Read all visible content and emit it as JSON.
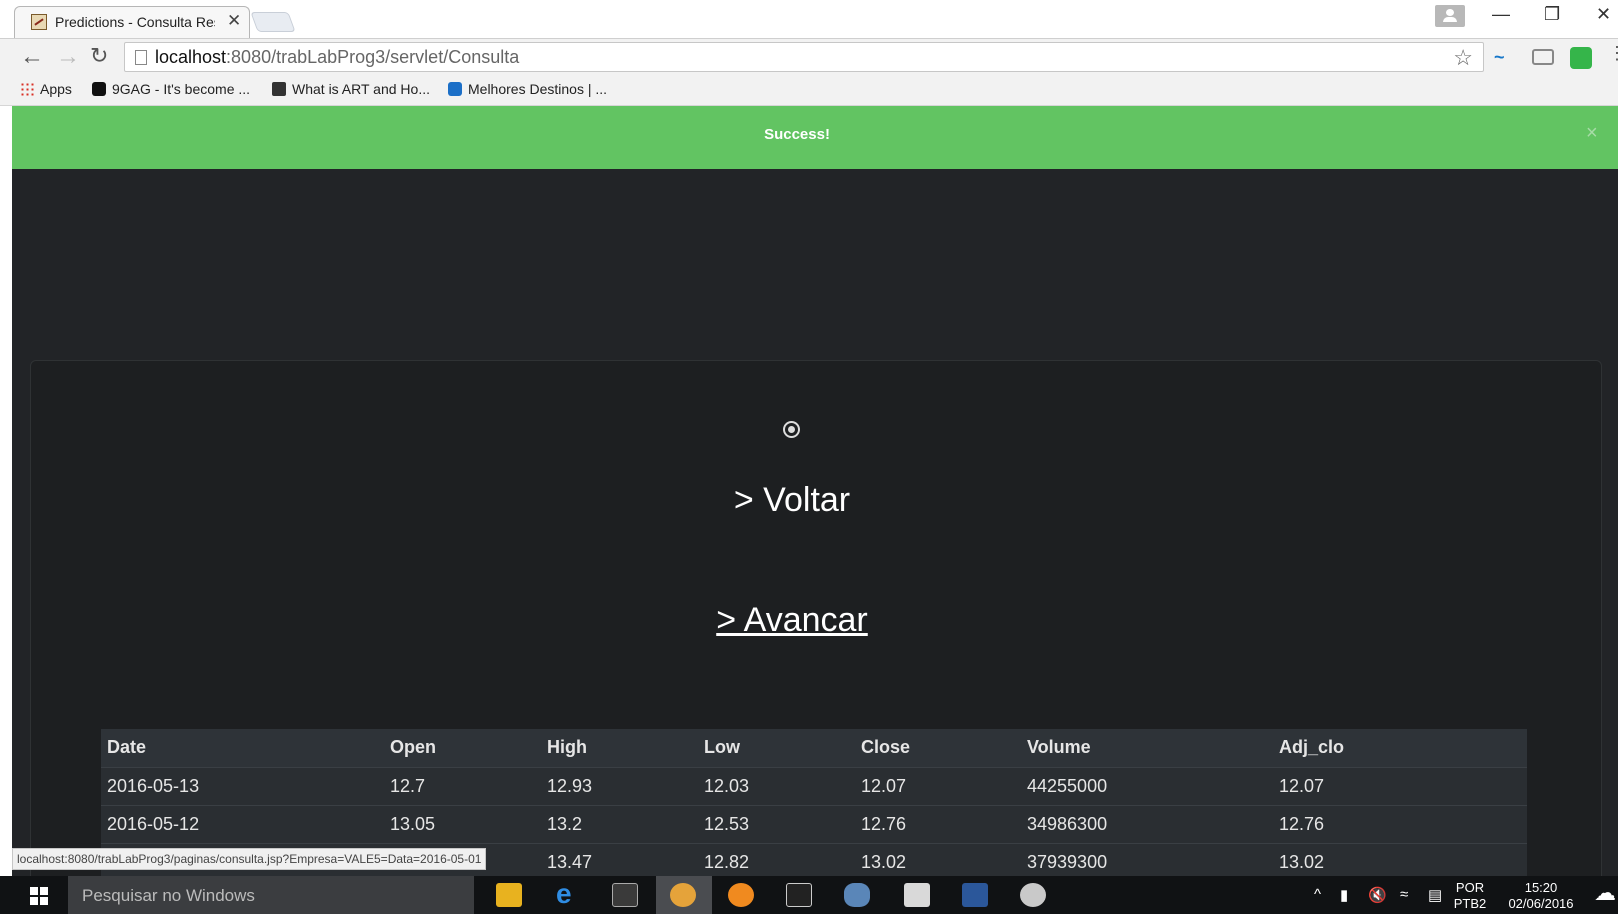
{
  "browser": {
    "tab_title": "Predictions - Consulta Res",
    "tab_close": "✕",
    "url_host": "localhost",
    "url_rest": ":8080/trabLabProg3/servlet/Consulta",
    "bookmarks": [
      "Apps",
      "9GAG - It's become ...",
      "What is ART and Ho...",
      "Melhores Destinos | ..."
    ]
  },
  "alert": {
    "text": "Success!",
    "close": "×",
    "color": "#62c462"
  },
  "links": {
    "voltar": "> Voltar",
    "avancar": "> Avancar"
  },
  "table": {
    "headers": [
      "Date",
      "Open",
      "High",
      "Low",
      "Close",
      "Volume",
      "Adj_clo"
    ],
    "rows": [
      [
        "2016-05-13",
        "12.7",
        "12.93",
        "12.03",
        "12.07",
        "44255000",
        "12.07"
      ],
      [
        "2016-05-12",
        "13.05",
        "13.2",
        "12.53",
        "12.76",
        "34986300",
        "12.76"
      ],
      [
        "",
        "",
        "13.47",
        "12.82",
        "13.02",
        "37939300",
        "13.02"
      ]
    ]
  },
  "status_url": "localhost:8080/trabLabProg3/paginas/consulta.jsp?Empresa=VALE5=Data=2016-05-01",
  "taskbar": {
    "search_placeholder": "Pesquisar no Windows",
    "lang_top": "POR",
    "lang_bottom": "PTB2",
    "time": "15:20",
    "date": "02/06/2016"
  },
  "icons": [
    "favicon-icon",
    "back-icon",
    "forward-icon",
    "reload-icon",
    "page-icon",
    "star-icon",
    "windows-start-icon",
    "file-explorer-icon",
    "edge-icon",
    "firefox-icon"
  ]
}
